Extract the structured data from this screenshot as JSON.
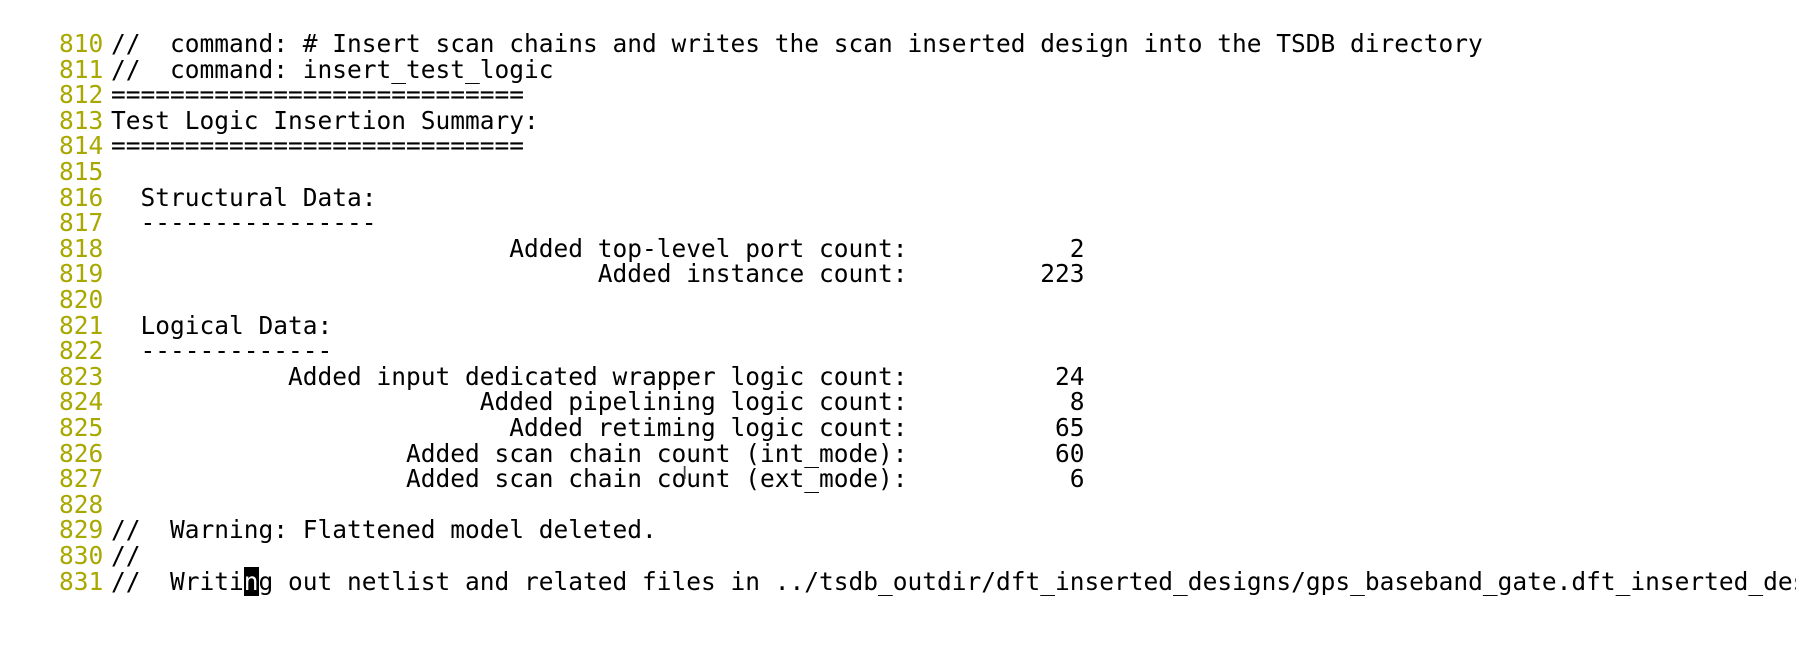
{
  "editor": {
    "colors": {
      "background": "#ffffff",
      "line_number": "#a8a800",
      "text": "#000000",
      "cursor_bg": "#000000",
      "cursor_fg": "#ffffff"
    },
    "lines": [
      {
        "num": "810",
        "text": "//  command: # Insert scan chains and writes the scan inserted design into the TSDB directory"
      },
      {
        "num": "811",
        "text": "//  command: insert_test_logic"
      },
      {
        "num": "812",
        "text": "============================"
      },
      {
        "num": "813",
        "text": "Test Logic Insertion Summary:"
      },
      {
        "num": "814",
        "text": "============================"
      },
      {
        "num": "815",
        "text": ""
      },
      {
        "num": "816",
        "text": "  Structural Data:"
      },
      {
        "num": "817",
        "text": "  ----------------"
      },
      {
        "num": "818",
        "text": "                           Added top-level port count:           2"
      },
      {
        "num": "819",
        "text": "                                 Added instance count:         223"
      },
      {
        "num": "820",
        "text": ""
      },
      {
        "num": "821",
        "text": "  Logical Data:"
      },
      {
        "num": "822",
        "text": "  -------------"
      },
      {
        "num": "823",
        "text": "            Added input dedicated wrapper logic count:          24"
      },
      {
        "num": "824",
        "text": "                         Added pipelining logic count:           8"
      },
      {
        "num": "825",
        "text": "                           Added retiming logic count:          65"
      },
      {
        "num": "826",
        "text": "                    Added scan chain count (int_mode):          60"
      },
      {
        "num": "827",
        "text": "                    Added scan chain count (ext_mode):           6"
      },
      {
        "num": "828",
        "text": ""
      },
      {
        "num": "829",
        "text": "//  Warning: Flattened model deleted."
      },
      {
        "num": "830",
        "text": "//"
      },
      {
        "num": "831",
        "text_before": "//  Writi",
        "cursor": "n",
        "text_after": "g out netlist and related files in ../tsdb_outdir/dft_inserted_designs/gps_baseband_gate.dft_inserted_design"
      }
    ],
    "mouse_pointer_icon": "text-ibeam-icon"
  }
}
